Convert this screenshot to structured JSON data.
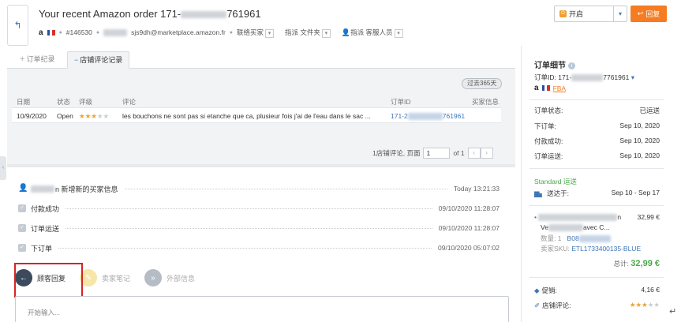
{
  "header": {
    "title_prefix": "Your recent Amazon order 171-",
    "title_suffix": "761961",
    "meta": {
      "amazon_logo": "a",
      "order_number": "#146530",
      "email_suffix": "sjs9dh@marketplace.amazon.fr",
      "contact_buyer": "联络买家",
      "assign_folder": "指派 文件夹",
      "assign_agent": "指派 客服人员"
    },
    "status_select": {
      "value": "开启",
      "icon": "O"
    },
    "reply_button": "回复"
  },
  "tabs": [
    {
      "label": "订单纪录",
      "icon": "+"
    },
    {
      "label": "店铺评论记录",
      "icon": "−"
    }
  ],
  "reviews": {
    "period_badge": "过去365天",
    "columns": {
      "date": "日期",
      "status": "状态",
      "rating": "评级",
      "comment": "评论",
      "order_id": "订单ID",
      "buyer_info": "买家信息"
    },
    "row": {
      "date": "10/9/2020",
      "status": "Open",
      "rating": 3,
      "comment": "les bouchons ne sont pas si etanche que ca, plusieur fois j'ai de l'eau dans le sac ...",
      "order_id_prefix": "171-2",
      "order_id_suffix": "761961"
    },
    "pager": {
      "summary": "1店铺评论, 页面",
      "page": "1",
      "of": "of 1"
    }
  },
  "timeline": [
    {
      "icon": "person",
      "text": "n 新增新的买家信息",
      "time": "Today 13:21:33"
    },
    {
      "icon": "check",
      "text": "付款成功",
      "time": "09/10/2020 11:28:07"
    },
    {
      "icon": "check",
      "text": "订单运送",
      "time": "09/10/2020 11:28:07"
    },
    {
      "icon": "check",
      "text": "下订单",
      "time": "09/10/2020 05:07:02"
    }
  ],
  "actions": {
    "customer_reply": "顾客回复",
    "seller_note": "卖家笔记",
    "external_info": "外部信息"
  },
  "reply_input": {
    "placeholder": "开始输入..."
  },
  "order_details": {
    "title": "订单细节",
    "order_id_prefix": "订单ID: 171-",
    "order_id_suffix": "7761961",
    "fba": "FBA",
    "status_label": "订单状态:",
    "status_value": "已运送",
    "ordered_label": "下订单:",
    "ordered_value": "Sep 10, 2020",
    "paid_label": "付款成功:",
    "paid_value": "Sep 10, 2020",
    "shipped_label": "订单运送:",
    "shipped_value": "Sep 10, 2020",
    "shipping_method": "Standard 运送",
    "deliver_label": "送达于:",
    "deliver_value": "Sep 10 - Sep 17",
    "item": {
      "name_suffix": "n",
      "price": "32,99 €",
      "line2_prefix": "Ve",
      "line2_suffix": "avec C...",
      "qty_label": "数量: 1",
      "asin_prefix": "B08",
      "sku_label": "卖家SKU:",
      "sku_value": "ETL1733400135-BLUE"
    },
    "total_label": "总计:",
    "total_value": "32,99 €",
    "promo_label": "促销:",
    "promo_value": "4,16 €",
    "review_label": "店铺评论:",
    "review_rating": 3
  },
  "colors": {
    "accent": "#3f77b8",
    "orange": "#f57c22",
    "green": "#4aa84a",
    "star": "#f0a030",
    "highlight": "#d62424"
  }
}
